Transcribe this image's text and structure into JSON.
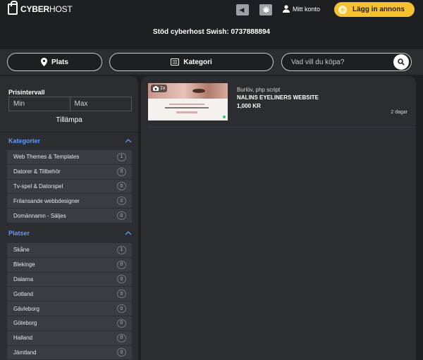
{
  "header": {
    "logo_bold": "CYBER",
    "logo_light": "HOST",
    "account_label": "Mitt konto",
    "add_button_label": "Lägg in annons",
    "icons": [
      "megaphone-icon",
      "star-badge-icon",
      "user-icon",
      "plus-icon"
    ]
  },
  "support_text": "Stöd cyberhost Swish: 0737888894",
  "search": {
    "location_label": "Plats",
    "category_label": "Kategori",
    "placeholder": "Vad vill du köpa?"
  },
  "filters": {
    "price_title": "Prisintervall",
    "min_placeholder": "Min",
    "max_placeholder": "Max",
    "apply_label": "Tillämpa",
    "categories_title": "Kategorier",
    "categories": [
      {
        "label": "Web Themes & Templates",
        "count": "1"
      },
      {
        "label": "Datorer & Tillbehör",
        "count": "0"
      },
      {
        "label": "Tv-spel & Datorspel",
        "count": "0"
      },
      {
        "label": "Frilansande webbdesigner",
        "count": "0"
      },
      {
        "label": "Domännamn - Säljes",
        "count": "0"
      }
    ],
    "places_title": "Platser",
    "places": [
      {
        "label": "Skåne",
        "count": "1"
      },
      {
        "label": "Blekinge",
        "count": "0"
      },
      {
        "label": "Dalarna",
        "count": "0"
      },
      {
        "label": "Gotland",
        "count": "0"
      },
      {
        "label": "Gävleborg",
        "count": "0"
      },
      {
        "label": "Göteborg",
        "count": "0"
      },
      {
        "label": "Halland",
        "count": "0"
      },
      {
        "label": "Jämtland",
        "count": "0"
      }
    ]
  },
  "listing": {
    "image_count": "1x",
    "meta": "Burlöv, php script",
    "title": "NALINS EYELINERS WEBSITE",
    "price": "1,000 KR",
    "date": "2 dagar"
  },
  "colors": {
    "accent": "#f6c131",
    "link": "#5f9bff",
    "background": "#1e1f22",
    "panel": "#2b2d31"
  }
}
